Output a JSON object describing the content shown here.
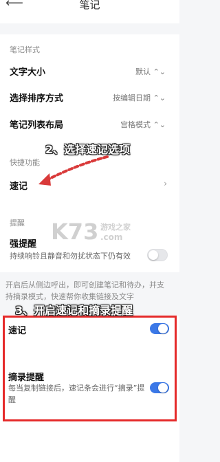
{
  "header": {
    "back_icon": "back-arrow-icon",
    "title": "笔记"
  },
  "style_section": {
    "heading": "笔记样式",
    "rows": [
      {
        "label": "文字大小",
        "value": "默认"
      },
      {
        "label": "选择排序方式",
        "value": "按编辑日期"
      },
      {
        "label": "笔记列表布局",
        "value": "宫格模式"
      }
    ]
  },
  "shortcut_section": {
    "heading": "快捷功能",
    "row_label": "速记"
  },
  "reminder_section": {
    "heading": "提醒",
    "strong_label": "强提醒",
    "strong_desc": "持续响铃且静音和勿扰状态下仍有效",
    "strong_on": false
  },
  "intro_text": "开启后从侧边呼出，即可创建笔记和待办，并支持摘录模式，快速帮你收集链接及文字",
  "bottom_section": {
    "quick_label": "速记",
    "quick_on": true,
    "excerpt_label": "摘录提醒",
    "excerpt_desc": "每当复制链接后，速记条会进行“摘录”提醒",
    "excerpt_on": true
  },
  "annotations": {
    "step2": "2、选择速记选项",
    "step3": "3、开启速记和摘录提醒",
    "arrow_color": "#d93a3a",
    "box_color": "#e52a2a"
  },
  "watermark": {
    "main": "K73",
    "sub": "游戏之家",
    "domain": ".com"
  },
  "colors": {
    "accent": "#3b78e7"
  }
}
